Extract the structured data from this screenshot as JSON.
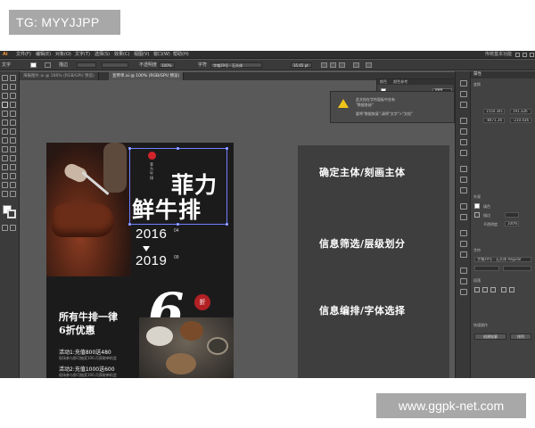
{
  "watermarks": {
    "top_tag": "TG: MYYJJPP",
    "bottom_tag": "www.ggpk-net.com"
  },
  "menubar": {
    "items": [
      "文件(F)",
      "编辑(E)",
      "对象(O)",
      "文字(T)",
      "选择(S)",
      "效果(C)",
      "视图(V)",
      "窗口(W)",
      "帮助(H)"
    ],
    "workspace": "传统基本功能"
  },
  "control_bar": {
    "label_left": "文字",
    "stroke_label": "描边",
    "opacity_label": "不透明度",
    "opacity_value": "100%",
    "font_label": "字符",
    "font_name": "字魂29号 - 石头体",
    "font_size": "35.65 pt"
  },
  "tabs": [
    {
      "label": "海报图片.ai @ 100% (RGB/GPU 预览)",
      "active": false
    },
    {
      "label": "宣传单.ai @ 100% (RGB/GPU 预览)",
      "active": true
    }
  ],
  "poster": {
    "brand_vertical": "菲力牛排",
    "title_line1": "菲力",
    "title_line2": "鲜牛排",
    "year_start": "2016",
    "year_start_suffix": "04",
    "year_end": "2019",
    "year_end_suffix": "09",
    "discount_digit": "6",
    "discount_badge": "折",
    "promo_line1": "所有牛排一律",
    "promo_line2": "6折优惠",
    "activity1": "活动1:充值800送480",
    "activity1_sub": "现场参与即可抽奖100,可获取单机会",
    "activity2": "活动2:充值1000送600",
    "activity2_sub": "现场参与即可抽奖100,可获取单机会"
  },
  "notes_panel": {
    "items": [
      "确定主体/刻画主体",
      "信息筛选/层级划分",
      "信息编排/字体选择"
    ]
  },
  "color_panel": {
    "tabs": [
      "颜色",
      "颜色参考"
    ],
    "hex": "ffffff"
  },
  "alert": {
    "line1": "此文档在字符面板中含有",
    "line2": "\"数据各缺\"",
    "line3": "要将\"数据恢复\",请将\"文字\">\"文档\""
  },
  "properties": {
    "title": "属性",
    "section_transform": "变换",
    "x_value": "1550.341",
    "y_value": "191.326",
    "w_value": "-8471.36",
    "h_value": "-210.436",
    "section_appearance": "外观",
    "fill_label": "填色",
    "stroke_label": "描边",
    "opacity_label": "不透明度",
    "opacity_value": "100%",
    "section_character": "字符",
    "font_name": "字魂29号 - 石头体 Regular",
    "section_paragraph": "段落",
    "quick_actions": "快速操作",
    "btn_outline": "创建轮廓",
    "btn_reset": "排列"
  },
  "colors": {
    "canvas_bg": "#595959",
    "poster_bg": "#1c1b1c",
    "notes_bg": "#3f3e3f",
    "selection": "#6e7fff",
    "accent_red": "#d2242a",
    "warn_yellow": "#f0c419"
  }
}
